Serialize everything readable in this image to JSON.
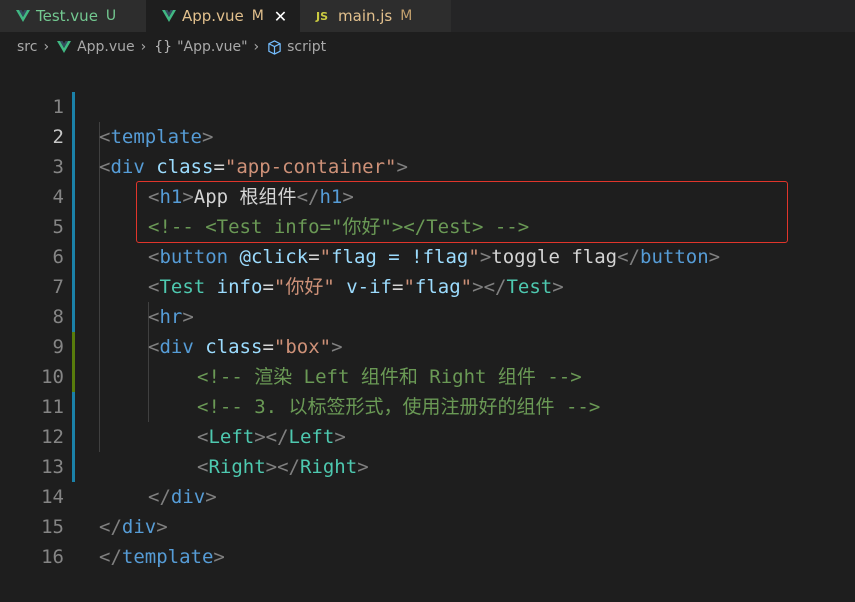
{
  "tabs": [
    {
      "name": "Test.vue",
      "status": "U"
    },
    {
      "name": "App.vue",
      "status": "M"
    },
    {
      "name": "main.js",
      "status": "M",
      "icon_text": "JS"
    }
  ],
  "close_glyph": "✕",
  "breadcrumb": {
    "folder": "src",
    "file": "App.vue",
    "braces": "{}",
    "symbol": "\"App.vue\"",
    "section": "script",
    "sep": "›"
  },
  "line_numbers": [
    "1",
    "2",
    "3",
    "4",
    "5",
    "6",
    "7",
    "8",
    "9",
    "10",
    "11",
    "12",
    "13",
    "14",
    "15",
    "16"
  ],
  "code": {
    "l1": {
      "lt": "<",
      "tag": "template",
      "gt": ">"
    },
    "l2": {
      "lt": "<",
      "tag": "div",
      "attr": "class",
      "eq": "=",
      "val": "\"app-container\"",
      "gt": ">"
    },
    "l3": {
      "lt": "<",
      "tag": "h1",
      "gt": ">",
      "text": "App 根组件",
      "lt2": "</",
      "tag2": "h1",
      "gt2": ">"
    },
    "l4": {
      "comment": "<!-- <Test info=\"你好\"></Test> -->"
    },
    "l5": {
      "lt": "<",
      "tag": "button",
      "attr": "@click",
      "eq": "=",
      "q1": "\"",
      "expr": "flag = !flag",
      "q2": "\"",
      "gt": ">",
      "text": "toggle flag",
      "lt2": "</",
      "tag2": "button",
      "gt2": ">"
    },
    "l6": {
      "lt": "<",
      "comp": "Test",
      "attr": "info",
      "eq": "=",
      "val": "\"你好\"",
      "attr2": "v-if",
      "eq2": "=",
      "q1": "\"",
      "expr": "flag",
      "q2": "\"",
      "gt": "></",
      "comp2": "Test",
      "gt2": ">"
    },
    "l7": {
      "lt": "<",
      "tag": "hr",
      "gt": ">"
    },
    "l8": {
      "lt": "<",
      "tag": "div",
      "attr": "class",
      "eq": "=",
      "val": "\"box\"",
      "gt": ">"
    },
    "l9": {
      "comment": "<!-- 渲染 Left 组件和 Right 组件 -->"
    },
    "l10": {
      "comment": "<!-- 3. 以标签形式，使用注册好的组件 -->"
    },
    "l11": {
      "lt": "<",
      "comp": "Left",
      "gt": "></",
      "comp2": "Left",
      "gt2": ">"
    },
    "l12": {
      "lt": "<",
      "comp": "Right",
      "gt": "></",
      "comp2": "Right",
      "gt2": ">"
    },
    "l13": {
      "lt": "</",
      "tag": "div",
      "gt": ">"
    },
    "l14": {
      "lt": "</",
      "tag": "div",
      "gt": ">"
    },
    "l15": {
      "lt": "</",
      "tag": "template",
      "gt": ">"
    }
  },
  "colors": {
    "vue": "#41b883",
    "modified_gutter": "#1b81a8",
    "added_gutter": "#587c0c",
    "highlight_border": "#e0352b"
  }
}
